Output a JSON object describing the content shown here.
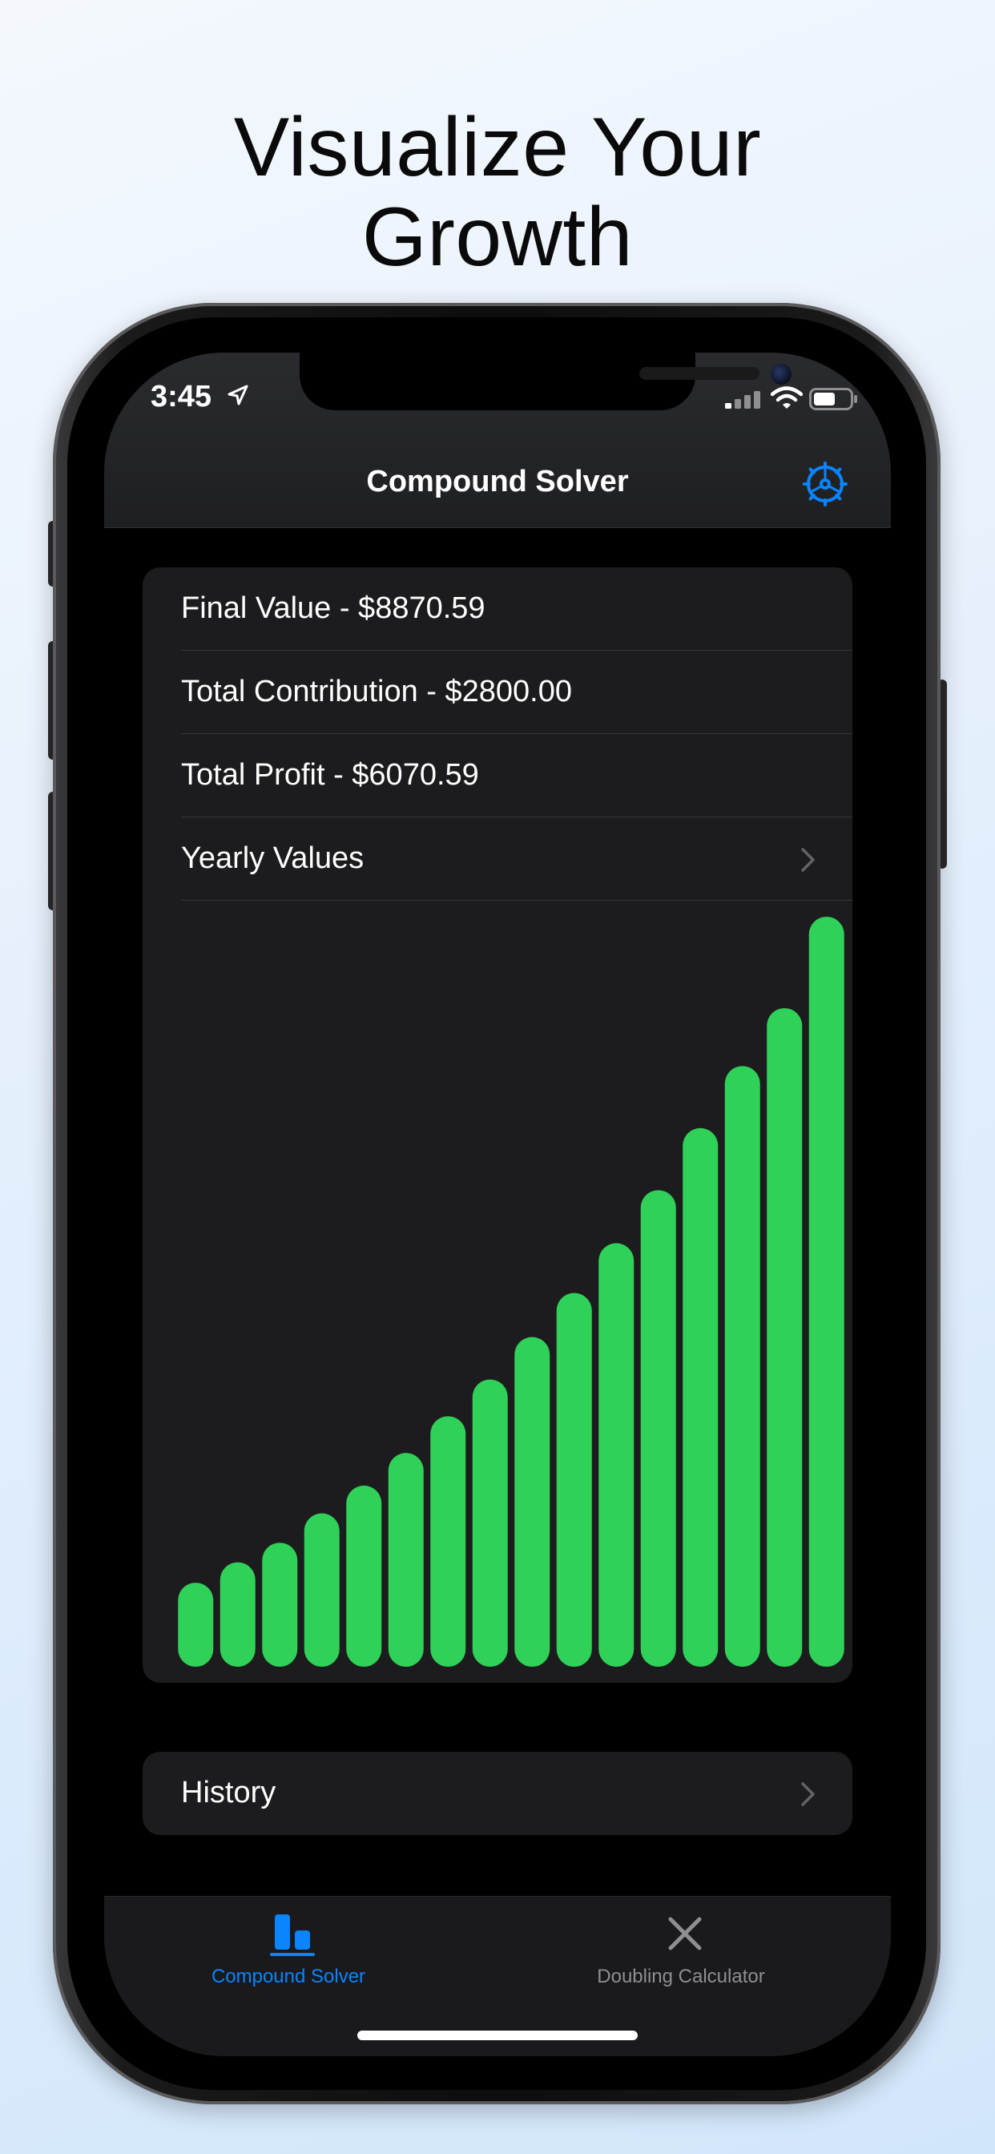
{
  "headline": {
    "line1": "Visualize Your",
    "line2": "Growth"
  },
  "status_bar": {
    "time": "3:45"
  },
  "navbar": {
    "title": "Compound Solver"
  },
  "results": {
    "rows": [
      {
        "label": "Final Value - $8870.59"
      },
      {
        "label": "Total Contribution - $2800.00"
      },
      {
        "label": "Total Profit - $6070.59"
      },
      {
        "label": "Yearly Values"
      }
    ]
  },
  "chart_data": {
    "type": "bar",
    "color": "#30d158",
    "categories": [
      "1",
      "2",
      "3",
      "4",
      "5",
      "6",
      "7",
      "8",
      "9",
      "10",
      "11",
      "12",
      "13",
      "14",
      "15",
      "16"
    ],
    "values": [
      103,
      128,
      152,
      188,
      222,
      262,
      307,
      352,
      404,
      458,
      519,
      584,
      660,
      736,
      807,
      919
    ],
    "ylim": [
      0,
      919
    ]
  },
  "history": {
    "label": "History"
  },
  "tabbar": {
    "tabs": [
      {
        "label": "Compound Solver",
        "active": true
      },
      {
        "label": "Doubling Calculator",
        "active": false
      }
    ]
  },
  "colors": {
    "accent": "#0a84ff",
    "bar": "#30d158",
    "card": "#1c1c1e",
    "inactive": "#8e8e93"
  }
}
